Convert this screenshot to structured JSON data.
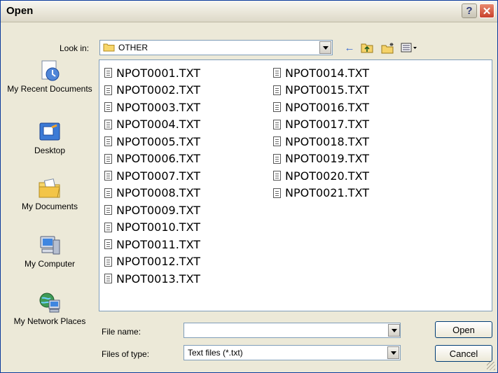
{
  "window": {
    "title": "Open",
    "help_glyph": "?",
    "close_glyph": "✕"
  },
  "look_in": {
    "label": "Look in:",
    "value": "OTHER"
  },
  "toolbar": {
    "back_icon": "back-arrow-icon",
    "up_icon": "up-folder-icon",
    "new_folder_icon": "new-folder-icon",
    "views_icon": "views-menu-icon"
  },
  "places": [
    {
      "label": "My Recent Documents",
      "icon": "recent-documents-icon"
    },
    {
      "label": "Desktop",
      "icon": "desktop-icon"
    },
    {
      "label": "My Documents",
      "icon": "my-documents-icon"
    },
    {
      "label": "My Computer",
      "icon": "my-computer-icon"
    },
    {
      "label": "My Network Places",
      "icon": "network-places-icon"
    }
  ],
  "files": {
    "col1": [
      "NPOT0001.TXT",
      "NPOT0002.TXT",
      "NPOT0003.TXT",
      "NPOT0004.TXT",
      "NPOT0005.TXT",
      "NPOT0006.TXT",
      "NPOT0007.TXT",
      "NPOT0008.TXT",
      "NPOT0009.TXT",
      "NPOT0010.TXT",
      "NPOT0011.TXT",
      "NPOT0012.TXT",
      "NPOT0013.TXT"
    ],
    "col2": [
      "NPOT0014.TXT",
      "NPOT0015.TXT",
      "NPOT0016.TXT",
      "NPOT0017.TXT",
      "NPOT0018.TXT",
      "NPOT0019.TXT",
      "NPOT0020.TXT",
      "NPOT0021.TXT"
    ]
  },
  "file_name": {
    "label": "File name:",
    "value": ""
  },
  "file_type": {
    "label": "Files of type:",
    "value": "Text files (*.txt)"
  },
  "buttons": {
    "open": "Open",
    "cancel": "Cancel"
  }
}
